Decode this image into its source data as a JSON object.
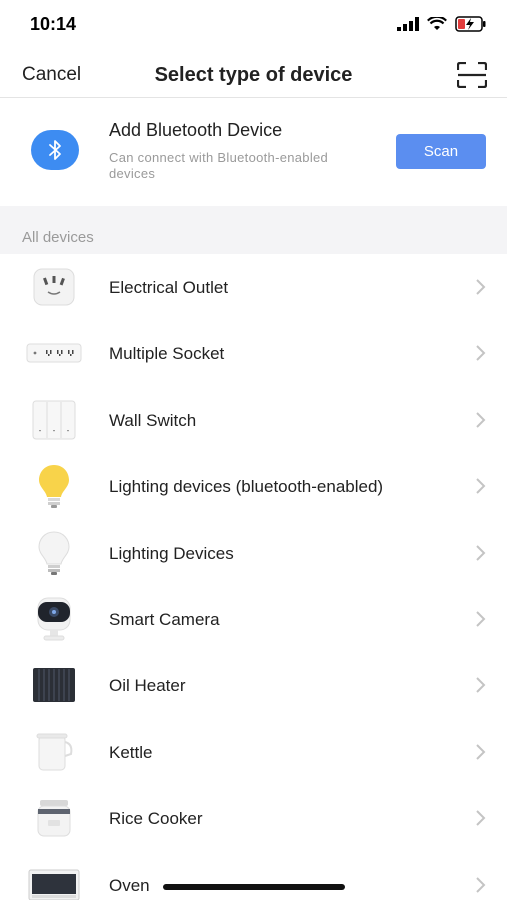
{
  "status_bar": {
    "time": "10:14"
  },
  "nav": {
    "cancel": "Cancel",
    "title": "Select type of device"
  },
  "bluetooth": {
    "title": "Add Bluetooth Device",
    "description": "Can connect with Bluetooth-enabled devices",
    "scan_label": "Scan",
    "accent": "#3d8cf2"
  },
  "section": {
    "label": "All devices"
  },
  "devices": [
    {
      "label": "Electrical Outlet",
      "icon": "outlet-icon"
    },
    {
      "label": "Multiple Socket",
      "icon": "power-strip-icon"
    },
    {
      "label": "Wall Switch",
      "icon": "wall-switch-icon"
    },
    {
      "label": "Lighting devices (bluetooth-enabled)",
      "icon": "yellow-bulb-icon"
    },
    {
      "label": "Lighting Devices",
      "icon": "white-bulb-icon"
    },
    {
      "label": "Smart Camera",
      "icon": "camera-icon"
    },
    {
      "label": "Oil Heater",
      "icon": "heater-icon"
    },
    {
      "label": "Kettle",
      "icon": "kettle-icon"
    },
    {
      "label": "Rice Cooker",
      "icon": "rice-cooker-icon"
    },
    {
      "label": "Oven",
      "icon": "oven-icon"
    }
  ]
}
